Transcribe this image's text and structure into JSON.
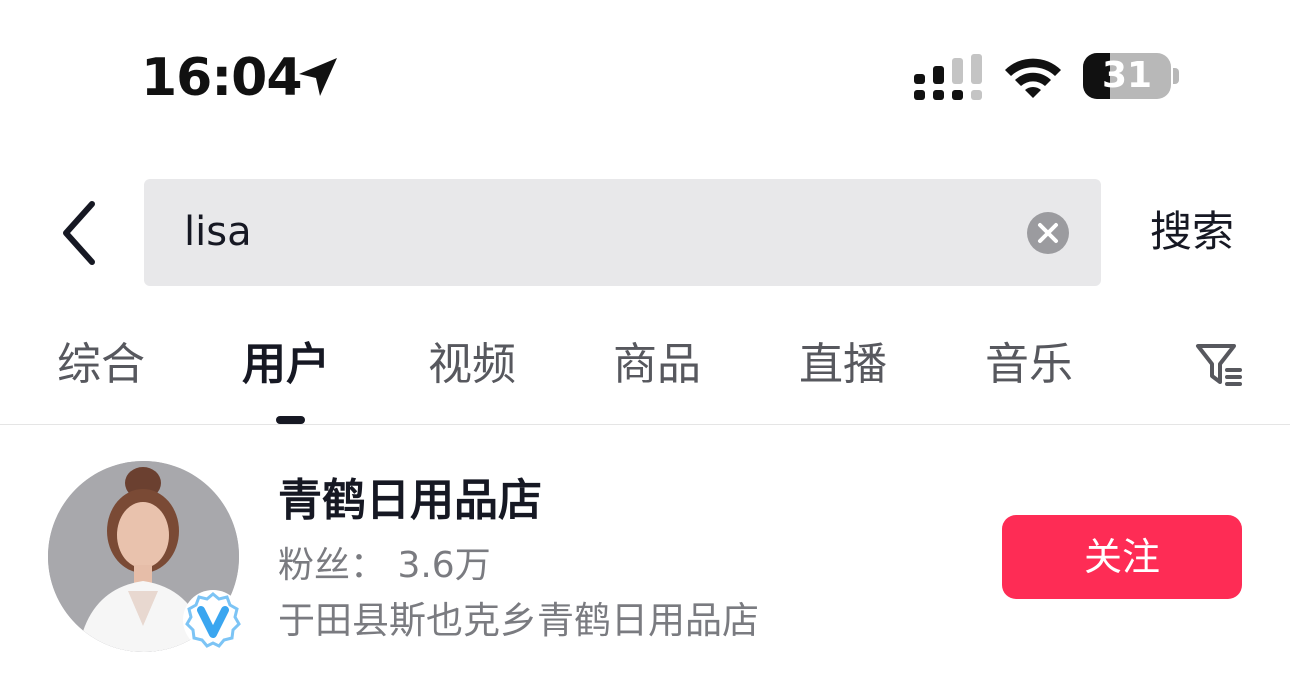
{
  "status_bar": {
    "time": "16:04",
    "battery": "31",
    "battery_level": 0.31,
    "icons": [
      "location-arrow-icon",
      "cellular-signal-icon",
      "wifi-icon",
      "battery-icon"
    ]
  },
  "search": {
    "value": "lisa",
    "submit_label": "搜索",
    "icons": [
      "back-chevron-icon",
      "clear-icon"
    ]
  },
  "tabs": [
    {
      "label": "综合",
      "active": false
    },
    {
      "label": "用户",
      "active": true
    },
    {
      "label": "视频",
      "active": false
    },
    {
      "label": "商品",
      "active": false
    },
    {
      "label": "直播",
      "active": false
    },
    {
      "label": "音乐",
      "active": false
    }
  ],
  "filter_icon": "filter-icon",
  "user_result": {
    "name": "青鹤日用品店",
    "followers": "粉丝： 3.6万",
    "description": "于田县斯也克乡青鹤日用品店",
    "follow_label": "关注",
    "verified_badge": "verified-v-badge-icon"
  },
  "colors": {
    "accent": "#fe2c55",
    "search_bg": "#e8e8ea",
    "text_primary": "#161823",
    "text_secondary": "#7a7b80",
    "badge_blue": "#3aa6f0"
  }
}
